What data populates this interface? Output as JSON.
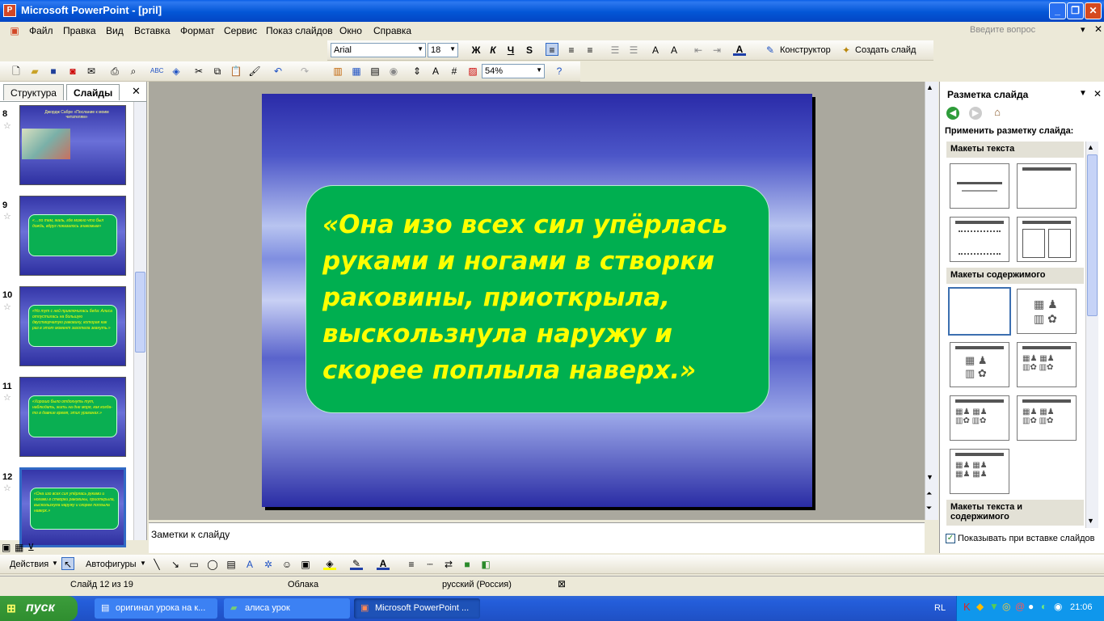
{
  "window": {
    "title": "Microsoft PowerPoint - [pril]",
    "min": "_",
    "max": "❐",
    "close": "✕"
  },
  "menu": {
    "items": [
      "Файл",
      "Правка",
      "Вид",
      "Вставка",
      "Формат",
      "Сервис",
      "Показ слайдов",
      "Окно",
      "Справка"
    ],
    "help_placeholder": "Введите вопрос"
  },
  "format": {
    "font": "Arial",
    "size": "18",
    "bold": "Ж",
    "italic": "К",
    "underline": "Ч",
    "shadow": "S",
    "designer": "Конструктор",
    "new_slide": "Создать слайд"
  },
  "standard": {
    "zoom": "54%"
  },
  "left_pane": {
    "tab_outline": "Структура",
    "tab_slides": "Слайды",
    "slides": [
      {
        "num": "8",
        "text": "Джордж Сабре «Послание к моим читателям»"
      },
      {
        "num": "9",
        "text": "«…по тем, жаль, где можно что был дождь, вдруг показалось знакомым»"
      },
      {
        "num": "10",
        "text": "«Но тут с ней приключилась беда: Алиса отпустилась на большую двустворчатую раковину, которая как раз в этот момент захотела зевнуть.»"
      },
      {
        "num": "11",
        "text": "«Хорошо было отдохнуть тут, наблюдать, жить на дне моря, как когда-то в давние время, этих ураганах.»"
      },
      {
        "num": "12",
        "text": "«Она изо всех сил упёрлась руками и ногами в створки раковины, приоткрыла, выскользнула наружу и скорее поплыла наверх.»"
      }
    ]
  },
  "slide": {
    "quote": "«Она изо всех сил упёрлась руками и ногами в створки раковины, приоткрыла, выскользнула наружу и скорее поплыла наверх.»"
  },
  "notes": {
    "placeholder": "Заметки к слайду"
  },
  "task_pane": {
    "title": "Разметка слайда",
    "apply": "Применить разметку слайда:",
    "sec_text": "Макеты текста",
    "sec_content": "Макеты содержимого",
    "sec_text_content": "Макеты текста и содержимого",
    "show_on_insert": "Показывать при вставке слайдов"
  },
  "drawing": {
    "actions": "Действия",
    "autoshapes": "Автофигуры"
  },
  "status": {
    "slide": "Слайд 12 из 19",
    "design": "Облака",
    "lang": "русский (Россия)"
  },
  "taskbar": {
    "start": "пуск",
    "tasks": [
      "оригинал урока на к...",
      "алиса урок",
      "Microsoft PowerPoint ..."
    ],
    "lang": "RL",
    "time": "21:06"
  }
}
